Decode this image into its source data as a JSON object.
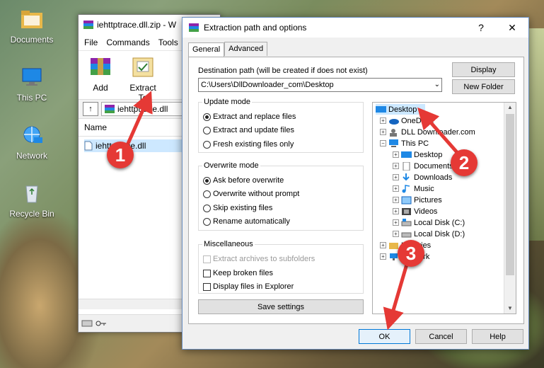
{
  "desktop": {
    "icons": [
      {
        "label": "Documents",
        "icon": "folder-icon"
      },
      {
        "label": "This PC",
        "icon": "computer-icon"
      },
      {
        "label": "Network",
        "icon": "network-icon"
      },
      {
        "label": "Recycle Bin",
        "icon": "recycle-bin-icon"
      }
    ]
  },
  "winrar": {
    "title": "iehttptrace.dll.zip - W",
    "menu": [
      "File",
      "Commands",
      "Tools"
    ],
    "tools": [
      {
        "label": "Add",
        "icon": "add-archive-icon"
      },
      {
        "label": "Extract To",
        "icon": "extract-to-icon"
      }
    ],
    "address": "iehttptrace.dll",
    "column_name": "Name",
    "file": "iehttptrace.dll"
  },
  "dialog": {
    "title": "Extraction path and options",
    "help_glyph": "?",
    "close_glyph": "✕",
    "tabs": [
      "General",
      "Advanced"
    ],
    "dest_label": "Destination path (will be created if does not exist)",
    "dest_value": "C:\\Users\\DllDownloader_com\\Desktop",
    "display_btn": "Display",
    "new_folder_btn": "New Folder",
    "update_mode": {
      "title": "Update mode",
      "options": [
        "Extract and replace files",
        "Extract and update files",
        "Fresh existing files only"
      ],
      "selected": 0
    },
    "overwrite_mode": {
      "title": "Overwrite mode",
      "options": [
        "Ask before overwrite",
        "Overwrite without prompt",
        "Skip existing files",
        "Rename automatically"
      ],
      "selected": 0
    },
    "misc": {
      "title": "Miscellaneous",
      "options": [
        "Extract archives to subfolders",
        "Keep broken files",
        "Display files in Explorer"
      ]
    },
    "save_settings": "Save settings",
    "tree": [
      "Desktop",
      "OneDrive",
      "DLL Downloader.com",
      "This PC",
      "Desktop",
      "Documents",
      "Downloads",
      "Music",
      "Pictures",
      "Videos",
      "Local Disk (C:)",
      "Local Disk (D:)",
      "Libraries",
      "Network"
    ],
    "ok": "OK",
    "cancel": "Cancel",
    "help": "Help"
  },
  "callouts": [
    "1",
    "2",
    "3"
  ],
  "colors": {
    "selection": "#cce8ff",
    "callout": "#e53935",
    "accent": "#0078d7"
  }
}
